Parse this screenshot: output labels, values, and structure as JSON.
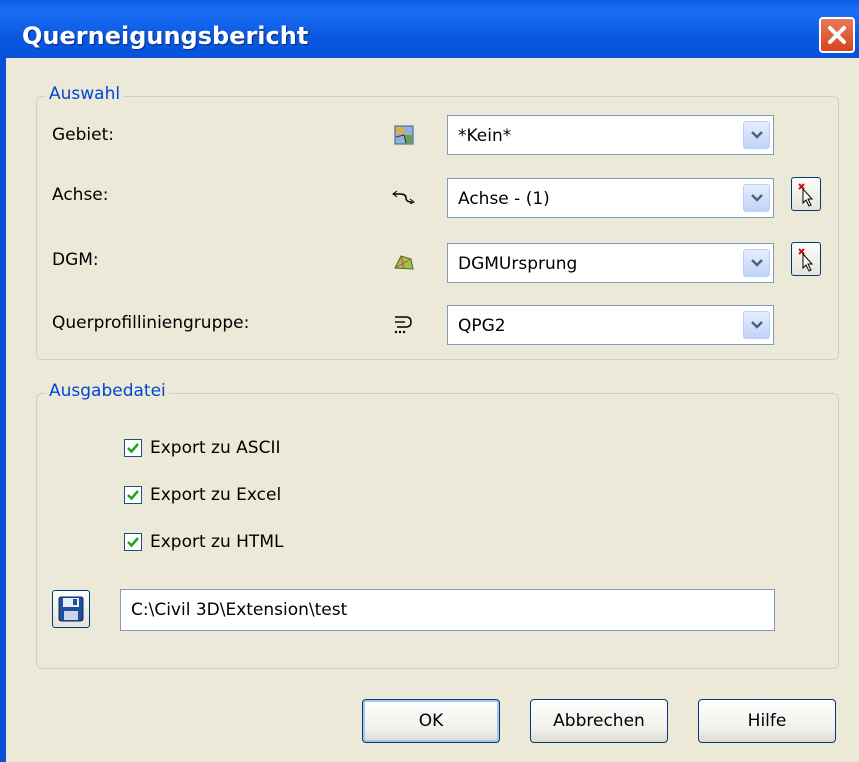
{
  "window": {
    "title": "Querneigungsbericht"
  },
  "auswahl": {
    "legend": "Auswahl",
    "gebiet": {
      "label": "Gebiet:",
      "value": "*Kein*"
    },
    "achse": {
      "label": "Achse:",
      "value": "Achse - (1)"
    },
    "dgm": {
      "label": "DGM:",
      "value": "DGMUrsprung"
    },
    "qpg": {
      "label": "Querprofilliniengruppe:",
      "value": "QPG2"
    }
  },
  "ausgabe": {
    "legend": "Ausgabedatei",
    "checkboxes": [
      {
        "label": "Export zu ASCII",
        "checked": true
      },
      {
        "label": "Export zu Excel",
        "checked": true
      },
      {
        "label": "Export zu HTML",
        "checked": true
      }
    ],
    "path": "C:\\Civil 3D\\Extension\\test"
  },
  "buttons": {
    "ok": "OK",
    "cancel": "Abbrechen",
    "help": "Hilfe"
  },
  "colors": {
    "titlebar": "#0550d6",
    "legend_text": "#0046d5",
    "dialog_bg": "#ece9d8",
    "close": "#d5451f"
  }
}
